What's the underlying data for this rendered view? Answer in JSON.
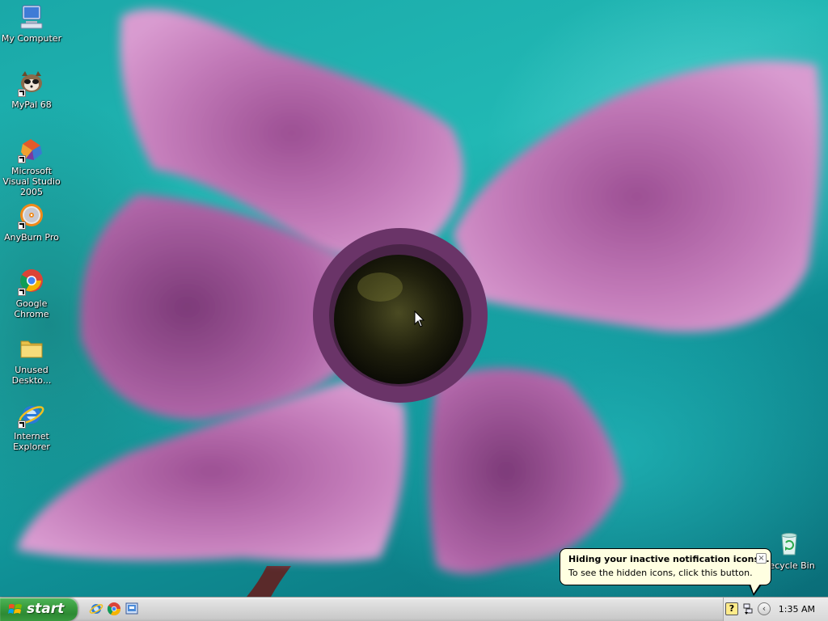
{
  "desktop": {
    "icons": [
      {
        "label": "My Computer",
        "icon": "my-computer-icon",
        "shortcut": false
      },
      {
        "label": "MyPal 68",
        "icon": "mypal-icon",
        "shortcut": true
      },
      {
        "label": "Microsoft Visual Studio 2005",
        "icon": "visual-studio-icon",
        "shortcut": true
      },
      {
        "label": "AnyBurn Pro",
        "icon": "anyburn-icon",
        "shortcut": true
      },
      {
        "label": "Google Chrome",
        "icon": "chrome-icon",
        "shortcut": true
      },
      {
        "label": "Unused Deskto...",
        "icon": "folder-icon",
        "shortcut": false
      },
      {
        "label": "Internet Explorer",
        "icon": "internet-explorer-icon",
        "shortcut": true
      }
    ],
    "recycle_bin": {
      "label": "Recycle Bin",
      "icon": "recycle-bin-icon"
    }
  },
  "balloon": {
    "title": "Hiding your inactive notification icons...",
    "text": "To see the hidden icons, click this button.",
    "close_glyph": "×"
  },
  "taskbar": {
    "start_label": "start",
    "quick_launch": [
      "internet-explorer-icon",
      "chrome-icon",
      "show-desktop-icon"
    ],
    "tray": {
      "help_glyph": "?",
      "expand_glyph": "‹",
      "clock": "1:35 AM"
    }
  },
  "colors": {
    "start_green": "#3a9d3f",
    "balloon_bg": "#ffffe1",
    "wallpaper_teal": "#1aa8a8",
    "petal_pink": "#c27ab8"
  }
}
